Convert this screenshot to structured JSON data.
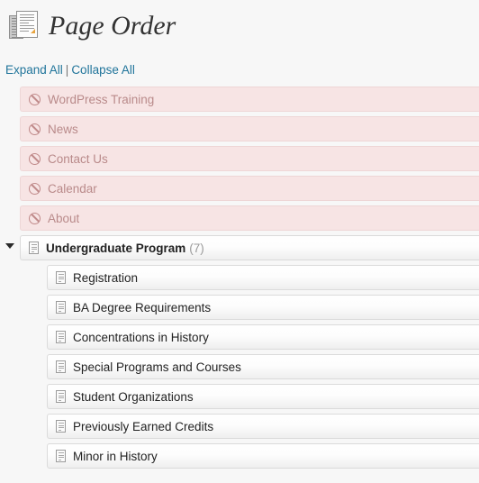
{
  "header": {
    "title": "Page Order",
    "icon": "documents-stack-icon"
  },
  "toolbar": {
    "expand_all": "Expand All",
    "separator": "|",
    "collapse_all": "Collapse All"
  },
  "colors": {
    "page_background": "#f7f7f7",
    "excluded_row_background": "#f7e4e4",
    "excluded_row_text": "#b98a8a",
    "link": "#21759b",
    "title_text": "#333333",
    "row_text": "#222222",
    "count_text": "#9a9a9a"
  },
  "tree": [
    {
      "label": "WordPress Training",
      "level": 0,
      "state": "excluded",
      "icon": "ban-icon",
      "expandable": false
    },
    {
      "label": "News",
      "level": 0,
      "state": "excluded",
      "icon": "ban-icon",
      "expandable": false
    },
    {
      "label": "Contact Us",
      "level": 0,
      "state": "excluded",
      "icon": "ban-icon",
      "expandable": false
    },
    {
      "label": "Calendar",
      "level": 0,
      "state": "excluded",
      "icon": "ban-icon",
      "expandable": false
    },
    {
      "label": "About",
      "level": 0,
      "state": "excluded",
      "icon": "ban-icon",
      "expandable": false
    },
    {
      "label": "Undergraduate Program",
      "level": 0,
      "state": "page",
      "icon": "page-icon",
      "expandable": true,
      "expanded": true,
      "child_count": "(7)",
      "bold": true
    },
    {
      "label": "Registration",
      "level": 1,
      "state": "page",
      "icon": "page-icon",
      "expandable": false
    },
    {
      "label": "BA Degree Requirements",
      "level": 1,
      "state": "page",
      "icon": "page-icon",
      "expandable": false
    },
    {
      "label": "Concentrations in History",
      "level": 1,
      "state": "page",
      "icon": "page-icon",
      "expandable": false
    },
    {
      "label": "Special Programs and Courses",
      "level": 1,
      "state": "page",
      "icon": "page-icon",
      "expandable": false
    },
    {
      "label": "Student Organizations",
      "level": 1,
      "state": "page",
      "icon": "page-icon",
      "expandable": false
    },
    {
      "label": "Previously Earned Credits",
      "level": 1,
      "state": "page",
      "icon": "page-icon",
      "expandable": false
    },
    {
      "label": "Minor in History",
      "level": 1,
      "state": "page",
      "icon": "page-icon",
      "expandable": false
    }
  ]
}
